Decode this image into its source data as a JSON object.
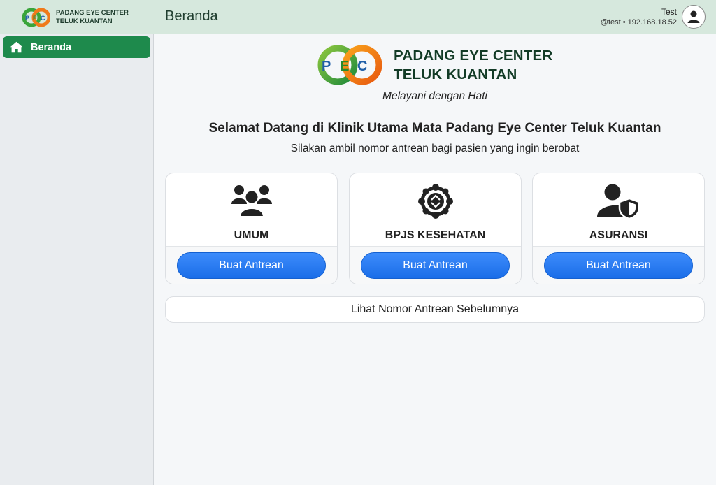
{
  "brand": {
    "logo_letters": [
      "P",
      "E",
      "C"
    ],
    "name_line1": "PADANG EYE CENTER",
    "name_line2": "TELUK KUANTAN"
  },
  "header": {
    "title": "Beranda",
    "user_name": "Test",
    "user_meta": "@test • 192.168.18.52"
  },
  "sidebar": {
    "items": [
      {
        "label": "Beranda",
        "icon": "home-icon",
        "active": true
      }
    ]
  },
  "hero": {
    "title_line1": "PADANG EYE CENTER",
    "title_line2": "TELUK KUANTAN",
    "tagline": "Melayani dengan Hati"
  },
  "welcome": {
    "heading": "Selamat Datang di Klinik Utama Mata Padang Eye Center Teluk Kuantan",
    "subtitle": "Silakan ambil nomor antrean bagi pasien yang ingin berobat"
  },
  "cards": [
    {
      "label": "UMUM",
      "icon": "people-group-icon",
      "button": "Buat Antrean"
    },
    {
      "label": "BPJS KESEHATAN",
      "icon": "bpjs-icon",
      "button": "Buat Antrean"
    },
    {
      "label": "ASURANSI",
      "icon": "user-shield-icon",
      "button": "Buat Antrean"
    }
  ],
  "previous": {
    "label": "Lihat Nomor Antrean Sebelumnya"
  },
  "colors": {
    "topbar": "#d6e8dd",
    "accent_green": "#1e8a4c",
    "button_blue": "#1a6de8",
    "logo_green": "#3aa53a",
    "logo_orange": "#f07a1a"
  }
}
